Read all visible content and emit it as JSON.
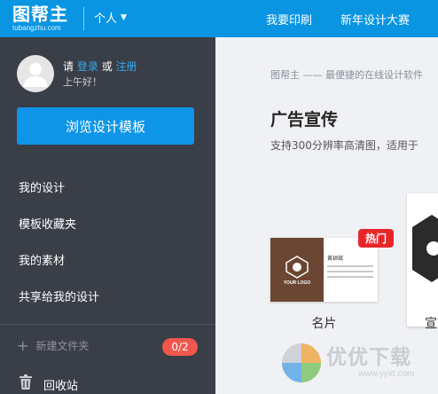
{
  "topbar": {
    "logo_text": "图帮主",
    "logo_domain": "tubangzhu.com",
    "account_type": "个人",
    "nav": [
      "我要印刷",
      "新年设计大赛"
    ]
  },
  "sidebar": {
    "greeting_prefix": "请",
    "login_link": "登录",
    "or_text": "或",
    "register_link": "注册",
    "greeting_time": "上午好！",
    "browse_button": "浏览设计模板",
    "items": [
      {
        "label": "我的设计"
      },
      {
        "label": "模板收藏夹"
      },
      {
        "label": "我的素材"
      },
      {
        "label": "共享给我的设计"
      }
    ],
    "new_folder": "新建文件夹",
    "folder_count": "0/2",
    "recycle_bin": "回收站"
  },
  "main": {
    "tagline": "图帮主 —— 最便捷的在线设计软件",
    "section_title": "广告宣传",
    "section_desc": "支持300分辨率高清图，适用于",
    "cards": [
      {
        "label": "名片",
        "badge": "热门",
        "thumb_name": "黄颖斌",
        "thumb_logo": "YOUR LOGO",
        "thumb_color": "#6b4632"
      },
      {
        "label": "宣"
      }
    ]
  },
  "watermark": {
    "text": "优优下载",
    "url": "www.yyxt.com"
  },
  "colors": {
    "topbar": "#0a95e2",
    "sidebar": "#3a3e47",
    "accent": "#0f95e8",
    "badge_red": "#f1574d",
    "hot_red": "#e8262a"
  },
  "icons": [
    "user-avatar-icon",
    "chevron-down-icon",
    "plus-icon",
    "trash-icon",
    "watermark-logo-icon"
  ]
}
